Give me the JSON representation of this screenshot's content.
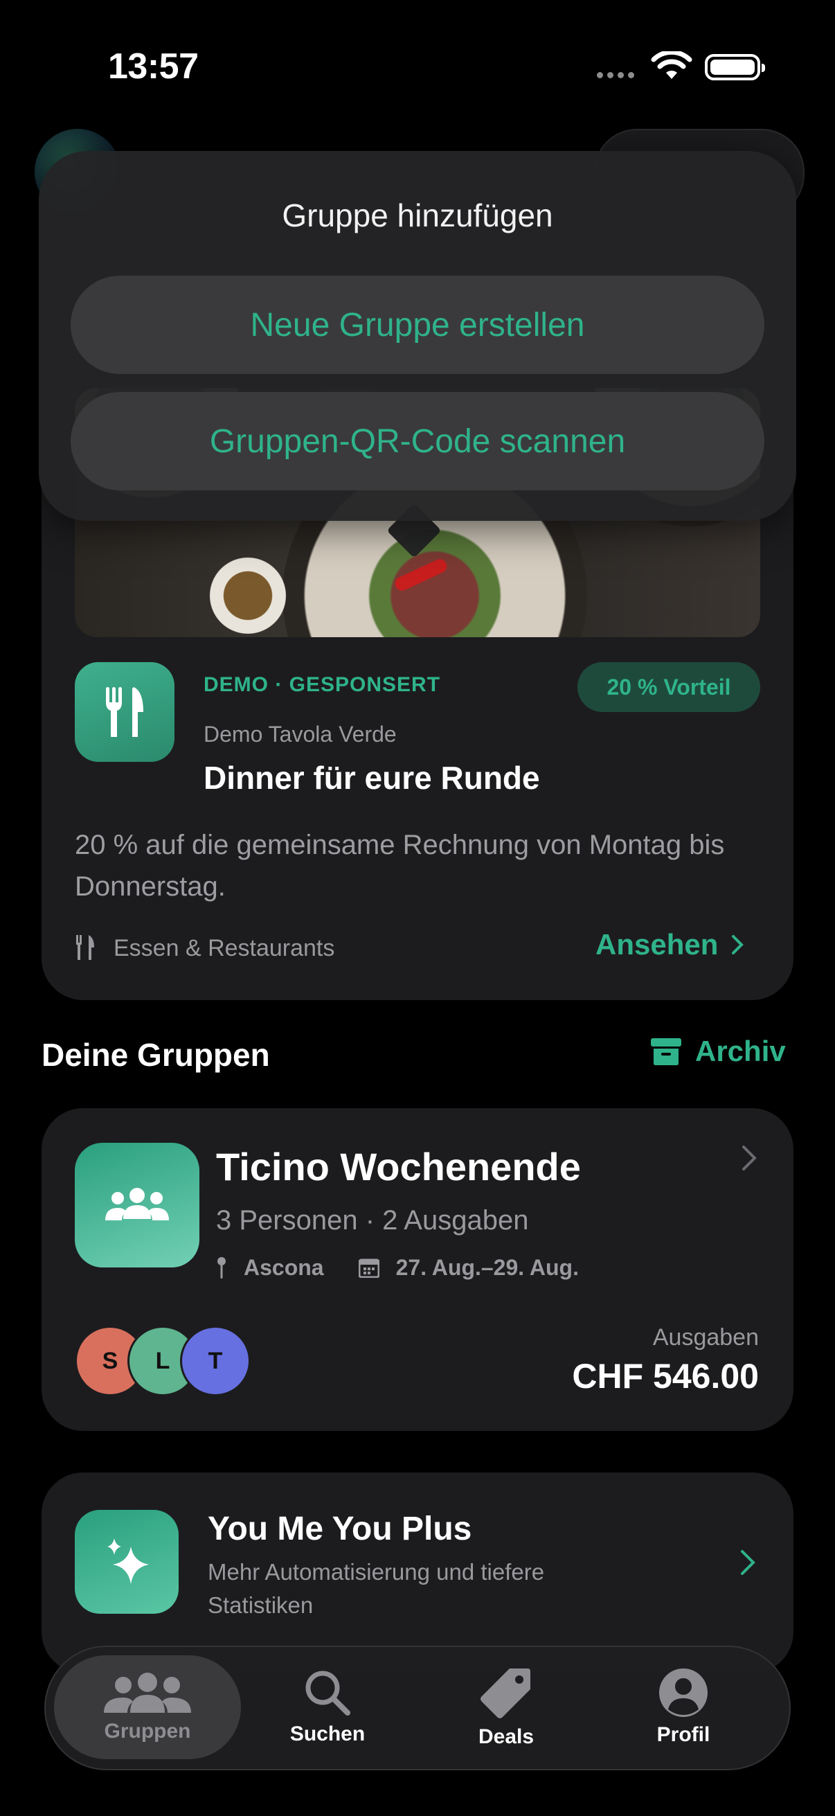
{
  "status_bar": {
    "time": "13:57"
  },
  "popover": {
    "title": "Gruppe hinzufügen",
    "create_label": "Neue Gruppe erstellen",
    "scan_label": "Gruppen-QR-Code scannen"
  },
  "promo": {
    "eyebrow": "DEMO · GESPONSERT",
    "badge": "20 % Vorteil",
    "merchant": "Demo Tavola Verde",
    "title": "Dinner für eure Runde",
    "description": "20 % auf die gemeinsame Rechnung von Montag bis Donnerstag.",
    "category": "Essen & Restaurants",
    "cta": "Ansehen"
  },
  "groups_section": {
    "title": "Deine Gruppen",
    "archive_label": "Archiv"
  },
  "group": {
    "name": "Ticino Wochenende",
    "meta": "3 Personen · 2 Ausgaben",
    "location": "Ascona",
    "dates": "27. Aug.–29. Aug.",
    "members": [
      {
        "initial": "S",
        "color": "#d9705e"
      },
      {
        "initial": "L",
        "color": "#5fb58f"
      },
      {
        "initial": "T",
        "color": "#6670e0"
      }
    ],
    "expenses_label": "Ausgaben",
    "expenses_value": "CHF 546.00"
  },
  "upsell": {
    "title": "You Me You Plus",
    "description": "Mehr Automatisierung und tiefere Statistiken"
  },
  "tabs": [
    {
      "label": "Gruppen",
      "icon": "people-icon",
      "active": true
    },
    {
      "label": "Suchen",
      "icon": "search-icon",
      "active": false
    },
    {
      "label": "Deals",
      "icon": "tag-icon",
      "active": false
    },
    {
      "label": "Profil",
      "icon": "person-circle-icon",
      "active": false
    }
  ],
  "colors": {
    "accent": "#2fb38a",
    "card": "#1c1c1e",
    "background": "#000000"
  }
}
